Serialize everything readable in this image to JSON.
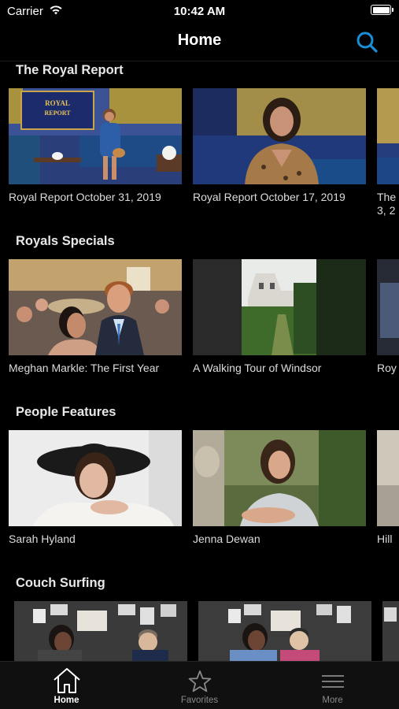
{
  "status_bar": {
    "carrier": "Carrier",
    "time": "10:42 AM"
  },
  "nav": {
    "title": "Home"
  },
  "sections": [
    {
      "title": "The Royal Report",
      "items": [
        {
          "caption": "Royal Report October 31, 2019"
        },
        {
          "caption": "Royal Report October 17, 2019"
        },
        {
          "caption": "The 3, 2"
        }
      ]
    },
    {
      "title": "Royals Specials",
      "items": [
        {
          "caption": "Meghan Markle: The First Year"
        },
        {
          "caption": "A Walking Tour of Windsor"
        },
        {
          "caption": "Roy"
        }
      ]
    },
    {
      "title": "People Features",
      "items": [
        {
          "caption": "Sarah Hyland"
        },
        {
          "caption": "Jenna Dewan"
        },
        {
          "caption": "Hill"
        }
      ]
    },
    {
      "title": "Couch Surfing",
      "items": []
    }
  ],
  "thumb_logo_text": "ROYAL REPORT",
  "tabs": [
    {
      "label": "Home",
      "icon": "home-icon",
      "active": true
    },
    {
      "label": "Favorites",
      "icon": "star-icon",
      "active": false
    },
    {
      "label": "More",
      "icon": "menu-icon",
      "active": false
    }
  ],
  "colors": {
    "accent": "#1a8fd6",
    "tab_active": "#ffffff",
    "tab_inactive": "#8a8a8a",
    "background": "#000000"
  }
}
